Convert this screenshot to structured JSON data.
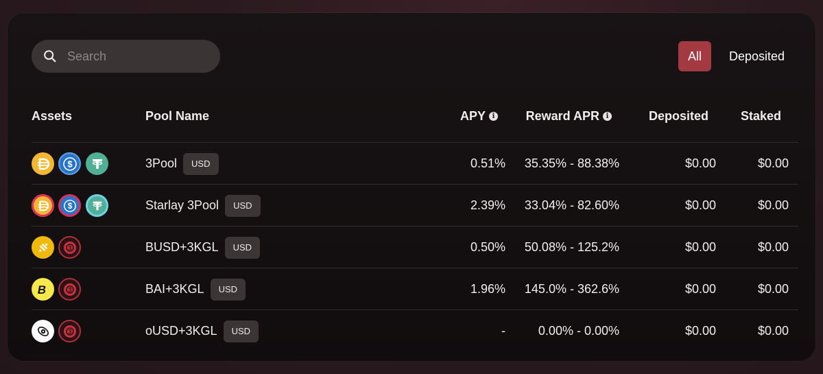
{
  "search": {
    "placeholder": "Search"
  },
  "filters": {
    "all": "All",
    "deposited": "Deposited"
  },
  "columns": {
    "assets": "Assets",
    "pool_name": "Pool Name",
    "apy": "APY",
    "reward_apr": "Reward APR",
    "deposited": "Deposited",
    "staked": "Staked"
  },
  "colors": {
    "accent": "#a33a42",
    "panel": "#151112",
    "badge": "#3b3536"
  },
  "rows": [
    {
      "name": "3Pool",
      "badge": "USD",
      "apy": "0.51%",
      "reward": "35.35% - 88.38%",
      "deposited": "$0.00",
      "staked": "$0.00",
      "icons": [
        "dai-icon",
        "usdc-icon",
        "usdt-icon"
      ]
    },
    {
      "name": "Starlay 3Pool",
      "badge": "USD",
      "apy": "2.39%",
      "reward": "33.04% - 82.60%",
      "deposited": "$0.00",
      "staked": "$0.00",
      "icons": [
        "starlay-dai-icon",
        "starlay-usdc-icon",
        "starlay-usdt-icon"
      ]
    },
    {
      "name": "BUSD+3KGL",
      "badge": "USD",
      "apy": "0.50%",
      "reward": "50.08% - 125.2%",
      "deposited": "$0.00",
      "staked": "$0.00",
      "icons": [
        "busd-icon",
        "3kgl-icon"
      ]
    },
    {
      "name": "BAI+3KGL",
      "badge": "USD",
      "apy": "1.96%",
      "reward": "145.0% - 362.6%",
      "deposited": "$0.00",
      "staked": "$0.00",
      "icons": [
        "bai-icon",
        "3kgl-icon"
      ]
    },
    {
      "name": "oUSD+3KGL",
      "badge": "USD",
      "apy": "-",
      "reward": "0.00% - 0.00%",
      "deposited": "$0.00",
      "staked": "$0.00",
      "icons": [
        "ousd-icon",
        "3kgl-icon"
      ]
    }
  ]
}
